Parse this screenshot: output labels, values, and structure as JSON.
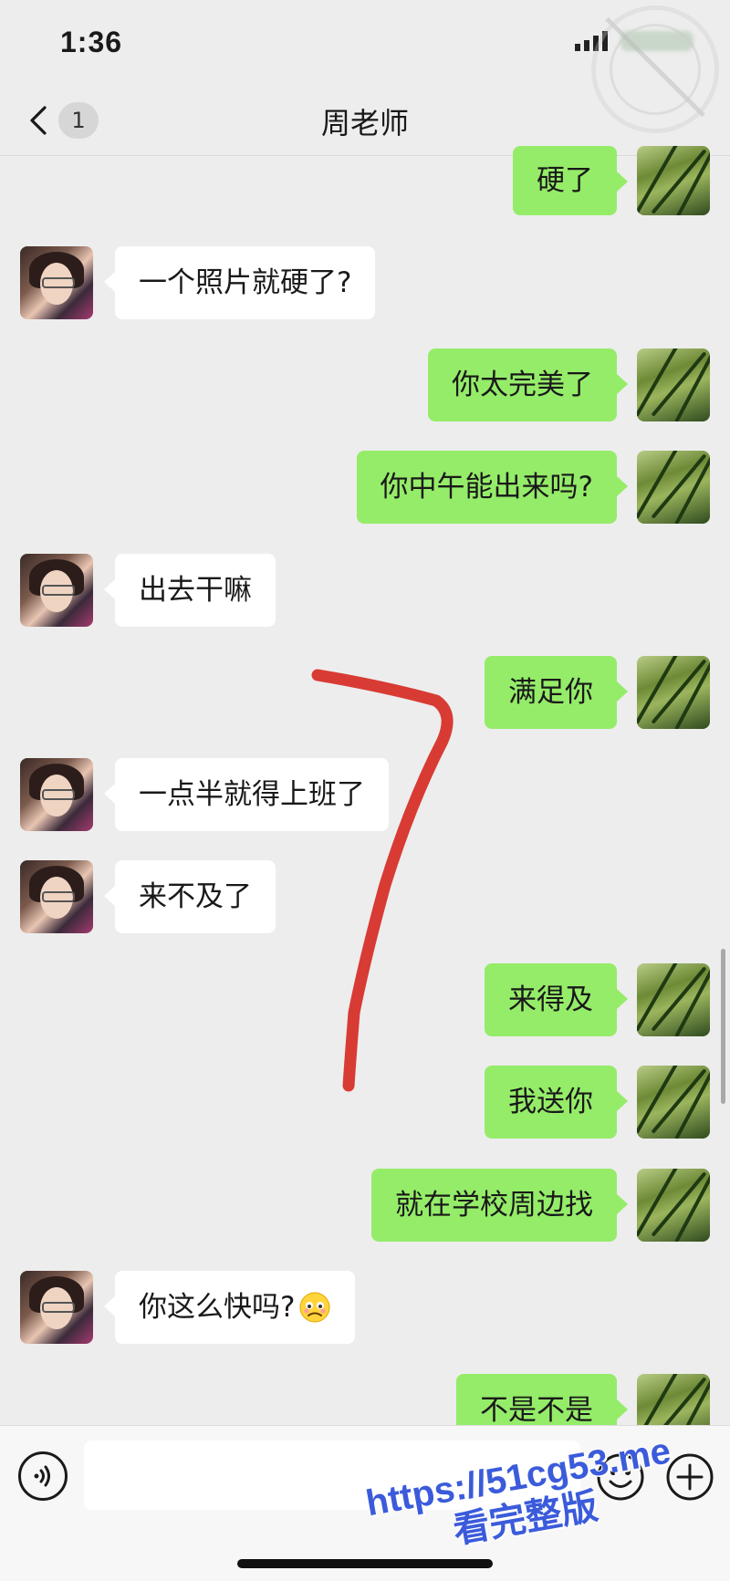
{
  "status_bar": {
    "time": "1:36"
  },
  "nav": {
    "unread_count": "1",
    "title": "周老师"
  },
  "messages": [
    {
      "side": "out",
      "text": "硬了"
    },
    {
      "side": "in",
      "text": "一个照片就硬了?"
    },
    {
      "side": "out",
      "text": "你太完美了"
    },
    {
      "side": "out",
      "text": "你中午能出来吗?"
    },
    {
      "side": "in",
      "text": "出去干嘛"
    },
    {
      "side": "out",
      "text": "满足你"
    },
    {
      "side": "in",
      "text": "一点半就得上班了"
    },
    {
      "side": "in",
      "text": "来不及了"
    },
    {
      "side": "out",
      "text": "来得及"
    },
    {
      "side": "out",
      "text": "我送你"
    },
    {
      "side": "out",
      "text": "就在学校周边找"
    },
    {
      "side": "in",
      "text": "你这么快吗?",
      "emoji": "worried-face-icon"
    },
    {
      "side": "out",
      "text": "不是不是"
    }
  ],
  "watermark": {
    "line1": "https://51cg53.me",
    "line2": "看完整版"
  },
  "colors": {
    "outgoing_bubble": "#95ec69",
    "incoming_bubble": "#ffffff",
    "background": "#ededed",
    "annotation_stroke": "#d7322a",
    "watermark_text": "#3b5bdb"
  }
}
